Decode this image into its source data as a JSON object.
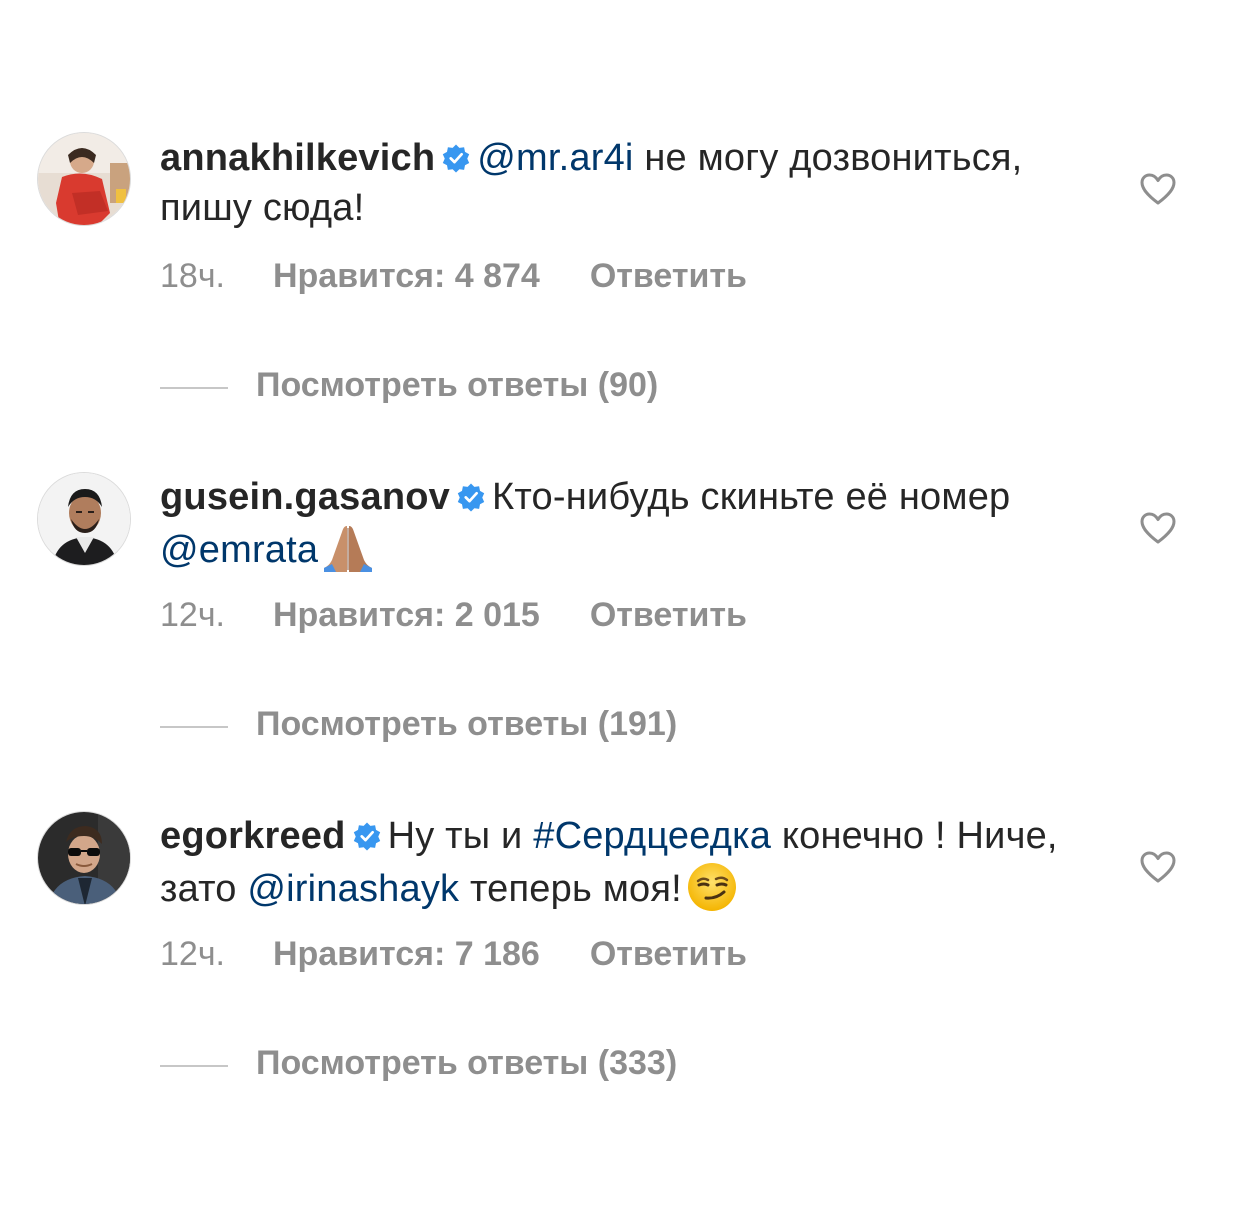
{
  "comments": [
    {
      "username": "annakhilkevich",
      "parts": [
        {
          "type": "mention",
          "text": "@mr.ar4i"
        },
        {
          "type": "text",
          "text": " не могу дозвониться, пишу сюда!"
        }
      ],
      "time": "18ч.",
      "likes": "Нравится: 4 874",
      "reply": "Ответить",
      "view_replies": "Посмотреть ответы (90)"
    },
    {
      "username": "gusein.gasanov",
      "parts": [
        {
          "type": "text",
          "text": "Кто-нибудь скиньте её номер "
        },
        {
          "type": "mention",
          "text": "@emrata"
        },
        {
          "type": "emoji",
          "name": "folded-hands"
        }
      ],
      "time": "12ч.",
      "likes": "Нравится: 2 015",
      "reply": "Ответить",
      "view_replies": "Посмотреть ответы (191)"
    },
    {
      "username": "egorkreed",
      "parts": [
        {
          "type": "text",
          "text": "Ну ты и "
        },
        {
          "type": "hashtag",
          "text": "#Сердцеедка"
        },
        {
          "type": "text",
          "text": " конечно ! Ниче, зато "
        },
        {
          "type": "mention",
          "text": "@irinashayk"
        },
        {
          "type": "text",
          "text": " теперь моя!"
        },
        {
          "type": "emoji",
          "name": "smirking-face"
        }
      ],
      "time": "12ч.",
      "likes": "Нравится: 7 186",
      "reply": "Ответить",
      "view_replies": "Посмотреть ответы (333)"
    }
  ],
  "colors": {
    "text": "#262626",
    "link": "#00376b",
    "muted": "#8e8e8e",
    "verified": "#3897f0"
  },
  "icons": {
    "verified": "verified-badge-icon",
    "like": "heart-outline-icon"
  }
}
